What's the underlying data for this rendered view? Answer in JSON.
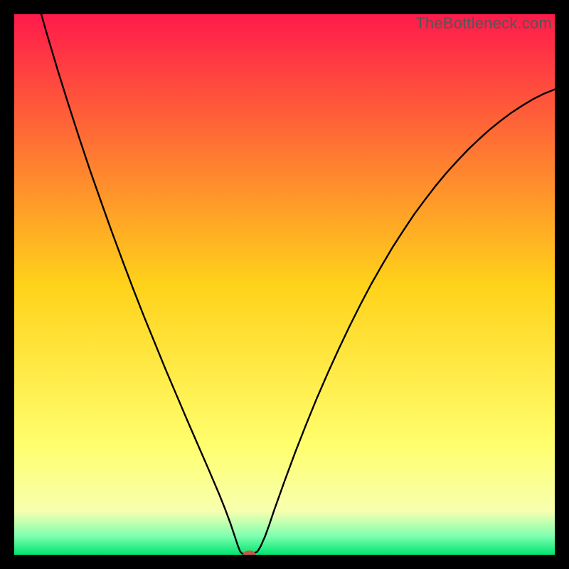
{
  "watermark": {
    "text": "TheBottleneck.com"
  },
  "chart_data": {
    "type": "line",
    "title": "",
    "xlabel": "",
    "ylabel": "",
    "xlim": [
      0,
      100
    ],
    "ylim": [
      0,
      100
    ],
    "background_gradient": {
      "stops": [
        {
          "pos": 0.0,
          "color": "#ff1a4b"
        },
        {
          "pos": 0.5,
          "color": "#ffd21a"
        },
        {
          "pos": 0.8,
          "color": "#ffff6e"
        },
        {
          "pos": 0.92,
          "color": "#f7ffb0"
        },
        {
          "pos": 0.965,
          "color": "#7fffb0"
        },
        {
          "pos": 1.0,
          "color": "#00e46f"
        }
      ]
    },
    "marker": {
      "x": 43.5,
      "y": 0,
      "color": "#c45a49",
      "rx": 9,
      "ry": 6
    },
    "series": [
      {
        "name": "curve",
        "stroke": "#000000",
        "stroke_width": 2.4,
        "points": [
          {
            "x": 5.0,
            "y": 100.0
          },
          {
            "x": 6.0,
            "y": 96.5
          },
          {
            "x": 8.0,
            "y": 89.8
          },
          {
            "x": 10.0,
            "y": 83.4
          },
          {
            "x": 12.0,
            "y": 77.2
          },
          {
            "x": 14.0,
            "y": 71.2
          },
          {
            "x": 16.0,
            "y": 65.5
          },
          {
            "x": 18.0,
            "y": 59.9
          },
          {
            "x": 20.0,
            "y": 54.5
          },
          {
            "x": 22.0,
            "y": 49.2
          },
          {
            "x": 24.0,
            "y": 44.1
          },
          {
            "x": 26.0,
            "y": 39.2
          },
          {
            "x": 28.0,
            "y": 34.3
          },
          {
            "x": 30.0,
            "y": 29.6
          },
          {
            "x": 32.0,
            "y": 24.9
          },
          {
            "x": 34.0,
            "y": 20.3
          },
          {
            "x": 36.0,
            "y": 15.7
          },
          {
            "x": 38.0,
            "y": 11.0
          },
          {
            "x": 39.0,
            "y": 8.5
          },
          {
            "x": 40.0,
            "y": 5.8
          },
          {
            "x": 40.8,
            "y": 3.4
          },
          {
            "x": 41.4,
            "y": 1.6
          },
          {
            "x": 41.8,
            "y": 0.6
          },
          {
            "x": 42.2,
            "y": 0.2
          },
          {
            "x": 43.0,
            "y": 0.2
          },
          {
            "x": 44.2,
            "y": 0.2
          },
          {
            "x": 45.0,
            "y": 0.6
          },
          {
            "x": 45.6,
            "y": 1.6
          },
          {
            "x": 46.4,
            "y": 3.4
          },
          {
            "x": 47.2,
            "y": 5.6
          },
          {
            "x": 48.0,
            "y": 8.0
          },
          {
            "x": 49.0,
            "y": 10.8
          },
          {
            "x": 50.0,
            "y": 13.6
          },
          {
            "x": 52.0,
            "y": 19.0
          },
          {
            "x": 54.0,
            "y": 24.1
          },
          {
            "x": 56.0,
            "y": 29.0
          },
          {
            "x": 58.0,
            "y": 33.6
          },
          {
            "x": 60.0,
            "y": 38.0
          },
          {
            "x": 62.0,
            "y": 42.2
          },
          {
            "x": 64.0,
            "y": 46.2
          },
          {
            "x": 66.0,
            "y": 50.0
          },
          {
            "x": 68.0,
            "y": 53.5
          },
          {
            "x": 70.0,
            "y": 56.9
          },
          {
            "x": 72.0,
            "y": 60.0
          },
          {
            "x": 74.0,
            "y": 63.0
          },
          {
            "x": 76.0,
            "y": 65.7
          },
          {
            "x": 78.0,
            "y": 68.3
          },
          {
            "x": 80.0,
            "y": 70.7
          },
          {
            "x": 82.0,
            "y": 72.9
          },
          {
            "x": 84.0,
            "y": 75.0
          },
          {
            "x": 86.0,
            "y": 76.9
          },
          {
            "x": 88.0,
            "y": 78.7
          },
          {
            "x": 90.0,
            "y": 80.3
          },
          {
            "x": 92.0,
            "y": 81.8
          },
          {
            "x": 94.0,
            "y": 83.1
          },
          {
            "x": 96.0,
            "y": 84.3
          },
          {
            "x": 98.0,
            "y": 85.3
          },
          {
            "x": 100.0,
            "y": 86.1
          }
        ]
      }
    ]
  }
}
